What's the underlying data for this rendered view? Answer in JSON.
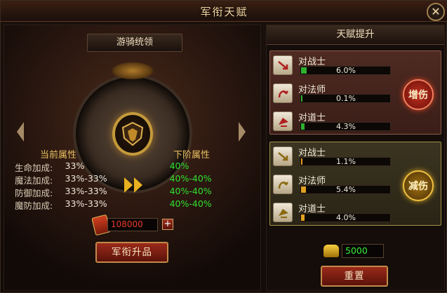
{
  "window": {
    "title": "军衔天赋"
  },
  "left": {
    "rank_tab": "游骑统领",
    "headers": {
      "current": "当前属性",
      "next": "下阶属性"
    },
    "attributes": [
      {
        "name": "生命加成:",
        "current": "33%",
        "next": "40%"
      },
      {
        "name": "魔法加成:",
        "current": "33%-33%",
        "next": "40%-40%"
      },
      {
        "name": "防御加成:",
        "current": "33%-33%",
        "next": "40%-40%"
      },
      {
        "name": "魔防加成:",
        "current": "33%-33%",
        "next": "40%-40%"
      }
    ],
    "cost": "108000",
    "plus": "+",
    "upgrade_button": "军衔升品"
  },
  "right": {
    "title": "天赋提升",
    "increase": [
      {
        "name": "对战士",
        "value": "6.0%",
        "fill": 0.06
      },
      {
        "name": "对法师",
        "value": "0.1%",
        "fill": 0.01
      },
      {
        "name": "对道士",
        "value": "4.3%",
        "fill": 0.043
      }
    ],
    "decrease": [
      {
        "name": "对战士",
        "value": "1.1%",
        "fill": 0.011
      },
      {
        "name": "对法师",
        "value": "5.4%",
        "fill": 0.054
      },
      {
        "name": "对道士",
        "value": "4.0%",
        "fill": 0.04
      }
    ],
    "increase_seal": "增伤",
    "decrease_seal": "减伤",
    "gold": "5000",
    "reset_button": "重置"
  },
  "colors": {
    "next_value": "#2ee02e",
    "cost": "#e83a2a",
    "gold_value": "#38f038",
    "increase_fill": "#2fb02f",
    "decrease_fill": "#e0a020"
  }
}
